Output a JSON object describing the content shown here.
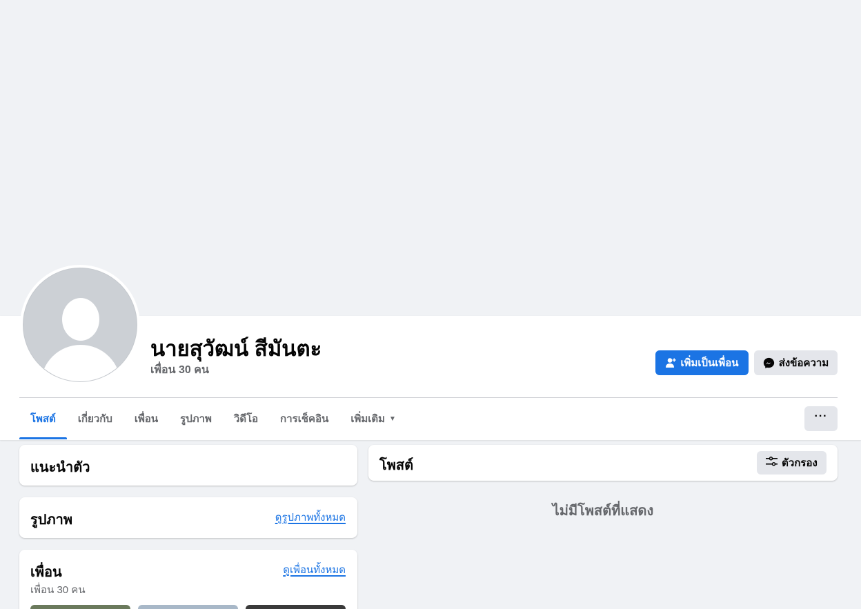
{
  "profile": {
    "name": "นายสุวัฒน์ สีมันตะ",
    "friend_count": "เพื่อน 30 คน"
  },
  "actions": {
    "add_friend_label": "เพิ่มเป็นเพื่อน",
    "message_label": "ส่งข้อความ",
    "more_label": "···"
  },
  "tabs": [
    {
      "label": "โพสต์",
      "active": true
    },
    {
      "label": "เกี่ยวกับ",
      "active": false
    },
    {
      "label": "เพื่อน",
      "active": false
    },
    {
      "label": "รูปภาพ",
      "active": false
    },
    {
      "label": "วิดีโอ",
      "active": false
    },
    {
      "label": "การเช็คอิน",
      "active": false
    },
    {
      "label": "เพิ่มเติม",
      "active": false
    }
  ],
  "intro": {
    "title": "แนะนำตัว"
  },
  "photos": {
    "title": "รูปภาพ",
    "link": "ดูรูปภาพทั้งหมด"
  },
  "friends": {
    "title": "เพื่อน",
    "link": "ดูเพื่อนทั้งหมด",
    "count": "เพื่อน 30 คน"
  },
  "posts": {
    "title": "โพสต์",
    "filter_label": "ตัวกรอง",
    "empty_text": "ไม่มีโพสต์ที่แสดง"
  },
  "colors": {
    "accent": "#1b74e4",
    "background": "#f0f2f5",
    "secondary_button": "#e4e6eb",
    "muted_text": "#65676b"
  },
  "thumbnail_colors": [
    "#6b7a5c",
    "#a8b8c8",
    "#3a3a3a"
  ]
}
